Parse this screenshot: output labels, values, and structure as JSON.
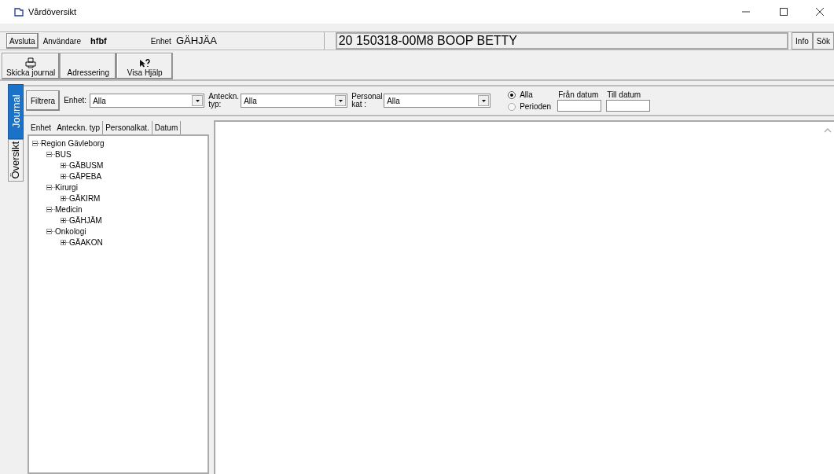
{
  "window": {
    "title": "Vårdöversikt"
  },
  "header": {
    "exit_button": "Avsluta",
    "user_label": "Användare",
    "user": "hfbf",
    "unit_label": "Enhet",
    "unit": "GÄHJÄA",
    "patient": "20 150318-00M8 BOOP BETTY",
    "buttons": [
      "Info",
      "Sök"
    ]
  },
  "toolbar": [
    {
      "label": "Skicka journal",
      "kind": "send"
    },
    {
      "label": "Adressering",
      "kind": "text"
    },
    {
      "label": "Visa Hjälp",
      "kind": "help"
    }
  ],
  "side_tabs": [
    {
      "label": "Journal",
      "selected": true
    },
    {
      "label": "Översikt",
      "selected": false
    }
  ],
  "filter": {
    "button": "Filtrera",
    "combos": [
      {
        "label": "Enhet:",
        "value": "Alla"
      },
      {
        "label": "Anteckn. typ:",
        "value": "Alla"
      },
      {
        "label": "Personal kat :",
        "value": "Alla"
      }
    ],
    "radios": [
      {
        "label": "Alla",
        "selected": true
      },
      {
        "label": "Perioden",
        "selected": false
      }
    ],
    "date_fields": [
      {
        "label": "Från datum"
      },
      {
        "label": "Till datum"
      }
    ]
  },
  "tree_tabs": [
    {
      "label": "Enhet",
      "selected": true
    },
    {
      "label": "Anteckn. typ",
      "selected": false
    },
    {
      "label": "Personalkat.",
      "selected": false
    },
    {
      "label": "Datum",
      "selected": false
    }
  ],
  "tree": [
    {
      "label": "Region Gävleborg",
      "expanded": true,
      "children": [
        {
          "label": "BUS",
          "expanded": true,
          "children": [
            {
              "label": "GÄBUSM",
              "expanded": false
            },
            {
              "label": "GÄPEBA",
              "expanded": false
            }
          ]
        },
        {
          "label": "Kirurgi",
          "expanded": true,
          "children": [
            {
              "label": "GÄKIRM",
              "expanded": false
            }
          ]
        },
        {
          "label": "Medicin",
          "expanded": true,
          "children": [
            {
              "label": "GÄHJÄM",
              "expanded": false
            }
          ]
        },
        {
          "label": "Onkologi",
          "expanded": true,
          "children": [
            {
              "label": "GÄAKON",
              "expanded": false
            }
          ]
        }
      ]
    }
  ]
}
